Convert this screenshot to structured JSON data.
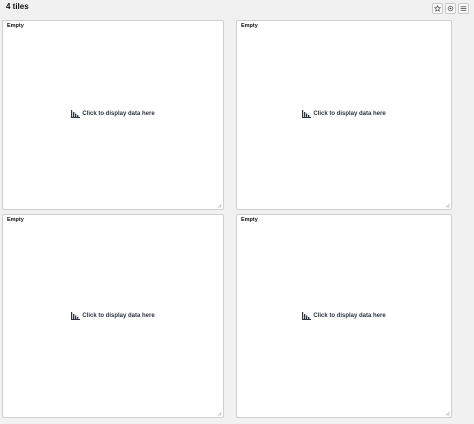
{
  "header": {
    "title": "4 tiles",
    "actions": [
      {
        "name": "star-button",
        "icon": "star-icon"
      },
      {
        "name": "settings-button",
        "icon": "gear-icon"
      },
      {
        "name": "menu-button",
        "icon": "hamburger-menu-icon"
      }
    ]
  },
  "tiles": [
    {
      "title": "Empty",
      "cta": "Click to display data here",
      "icon": "bar-chart-icon"
    },
    {
      "title": "Empty",
      "cta": "Click to display data here",
      "icon": "bar-chart-icon"
    },
    {
      "title": "Empty",
      "cta": "Click to display data here",
      "icon": "bar-chart-icon"
    },
    {
      "title": "Empty",
      "cta": "Click to display data here",
      "icon": "bar-chart-icon"
    }
  ],
  "colors": {
    "page_bg": "#f1f1f1",
    "tile_bg": "#ffffff",
    "tile_border": "#cfcfcf",
    "icon": "#2b3440"
  }
}
